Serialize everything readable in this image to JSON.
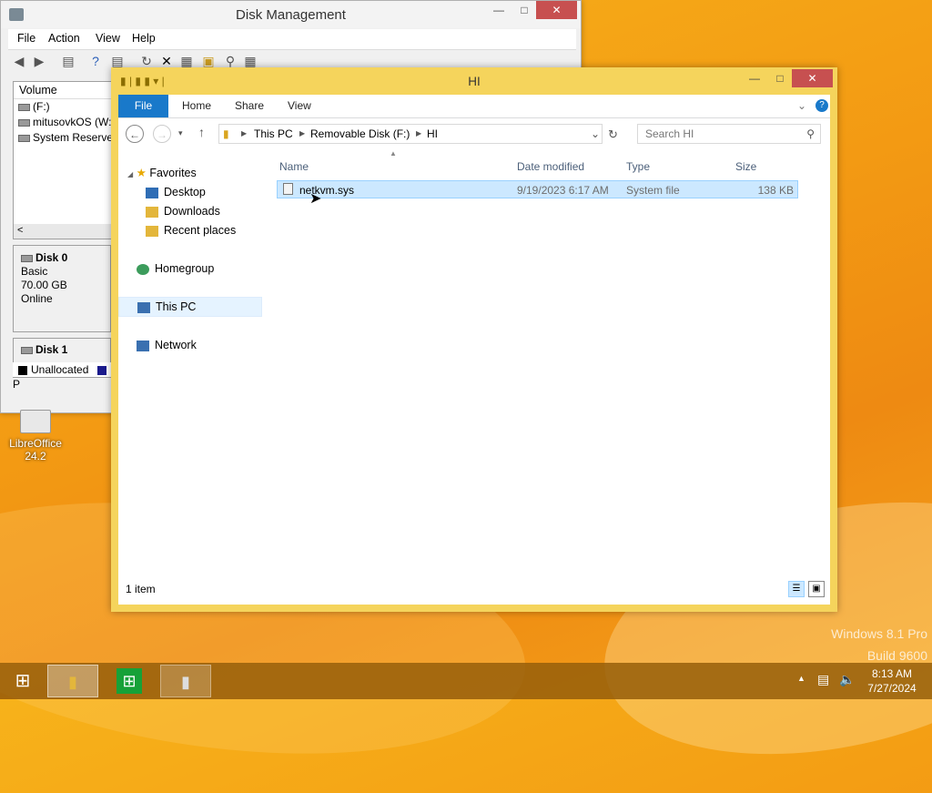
{
  "disk_management": {
    "title": "Disk Management",
    "menu": [
      "File",
      "Action",
      "View",
      "Help"
    ],
    "volume_header": "Volume",
    "volumes": [
      "(F:)",
      "mitusovkOS (W:)",
      "System Reserved"
    ],
    "disk0": {
      "name": "Disk 0",
      "type": "Basic",
      "size": "70.00 GB",
      "status": "Online"
    },
    "disk1": {
      "name": "Disk 1"
    },
    "legend": [
      "Unallocated",
      "P"
    ]
  },
  "desktop": {
    "libreoffice_label_1": "LibreOffice",
    "libreoffice_label_2": "24.2"
  },
  "explorer": {
    "title": "HI",
    "ribbon_tabs": [
      "File",
      "Home",
      "Share",
      "View"
    ],
    "breadcrumb": [
      "This PC",
      "Removable Disk (F:)",
      "HI"
    ],
    "search_placeholder": "Search HI",
    "nav": {
      "favorites": "Favorites",
      "desktop": "Desktop",
      "downloads": "Downloads",
      "recent": "Recent places",
      "homegroup": "Homegroup",
      "thispc": "This PC",
      "network": "Network"
    },
    "columns": [
      "Name",
      "Date modified",
      "Type",
      "Size"
    ],
    "files": [
      {
        "name": "netkvm.sys",
        "date": "9/19/2023 6:17 AM",
        "type": "System file",
        "size": "138 KB"
      }
    ],
    "status": "1 item"
  },
  "watermark": {
    "line1": "Windows 8.1 Pro",
    "line2": "Build 9600"
  },
  "taskbar": {
    "time": "8:13 AM",
    "date": "7/27/2024"
  },
  "colors": {
    "accent": "#1979ca",
    "selection": "#cce8ff",
    "explorer_frame": "#f5d45c"
  }
}
